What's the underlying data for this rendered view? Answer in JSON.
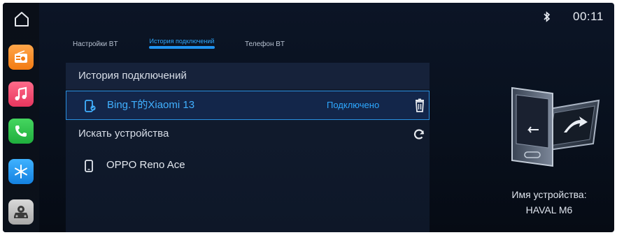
{
  "status": {
    "time": "00:11",
    "bluetooth_icon": "bluetooth-icon"
  },
  "dock": {
    "items": [
      {
        "name": "home-icon"
      },
      {
        "name": "radio-app-icon",
        "color": "#f58b24"
      },
      {
        "name": "music-app-icon",
        "color": "#f04a6e"
      },
      {
        "name": "phone-app-icon",
        "color": "#2fc44b"
      },
      {
        "name": "climate-app-icon",
        "color": "#2496f2"
      },
      {
        "name": "vehicle-settings-app-icon",
        "color": "#bdbdbd"
      }
    ]
  },
  "tabs": [
    {
      "label": "Настройки BT",
      "active": false
    },
    {
      "label": "История подключений",
      "active": true
    },
    {
      "label": "Телефон BT",
      "active": false
    }
  ],
  "history": {
    "header": "История подключений",
    "connected_device": {
      "name": "Bing.T的Xiaomi 13",
      "status": "Подключено",
      "icon": "phone-connected-icon"
    }
  },
  "search": {
    "header": "Искать устройства",
    "found_device": {
      "name": "OPPO Reno Ace",
      "icon": "phone-icon"
    }
  },
  "device_info": {
    "label": "Имя устройства:",
    "value": "HAVAL M6"
  },
  "colors": {
    "accent": "#2ea8ff",
    "background": "#0b1322"
  }
}
